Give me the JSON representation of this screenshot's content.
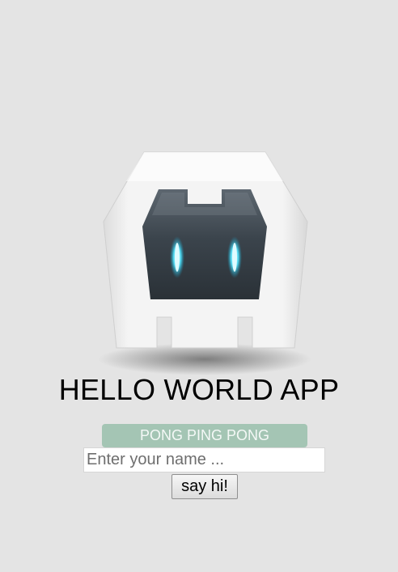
{
  "app": {
    "logo_icon": "cordova-robot-icon",
    "title": "HELLO WORLD APP",
    "event_text": "PONG PING PONG",
    "event_color": "#a4c5b4"
  },
  "form": {
    "name_placeholder": "Enter your name ...",
    "name_value": "",
    "say_hi_label": "say hi!"
  }
}
